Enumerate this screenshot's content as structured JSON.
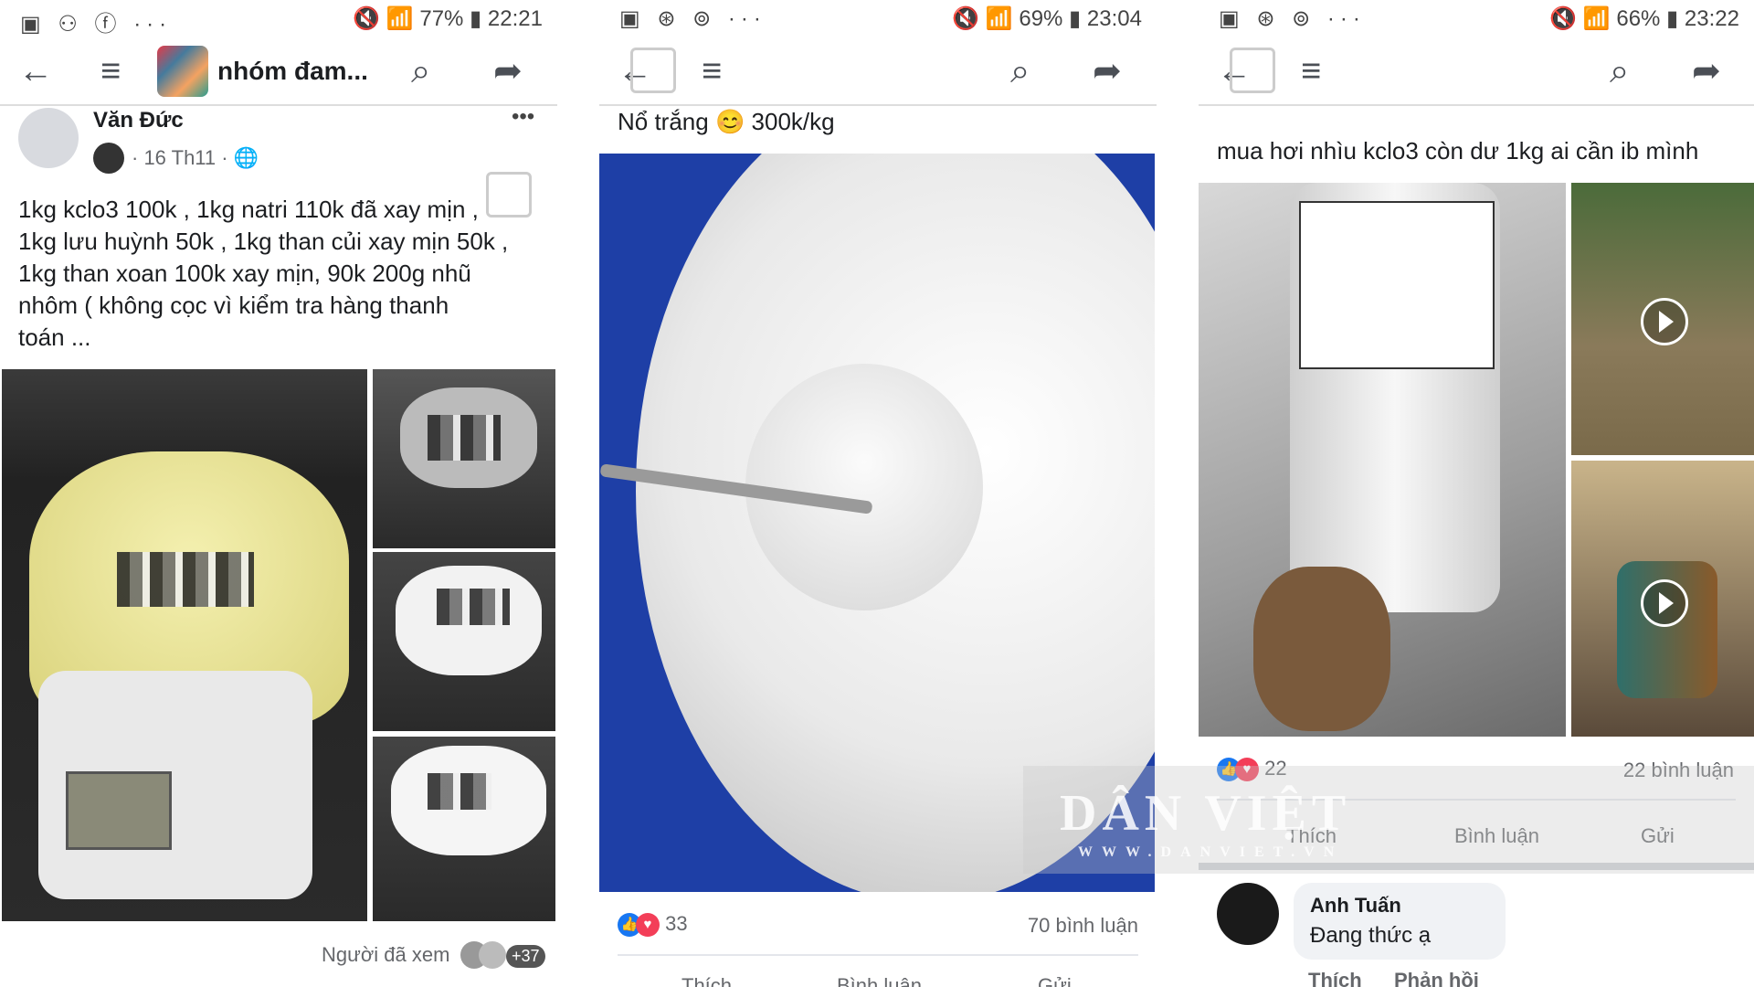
{
  "panel1": {
    "status": {
      "left_icons": "▣ ⚇ ⓕ ···",
      "right": "🔇 📶 77% ▮ 22:21"
    },
    "nav": {
      "back": "←",
      "menu": "≡",
      "title": "nhóm đam...",
      "search": "⌕",
      "share": "➦"
    },
    "post": {
      "author": "Văn Đức",
      "date": "· 16 Th11 · 🌐",
      "more": "•••",
      "text": [
        "1kg kclo3 100k , 1kg natri 110k đã xay mịn ,",
        "1kg lưu huỳnh 50k ,  1kg than củi xay mịn 50k ,",
        "1kg than xoan 100k xay mịn, 90k 200g nhũ",
        "nhôm ( không cọc vì kiểm tra hàng thanh",
        "toán ..."
      ],
      "seen": "Người đã xem",
      "seen_count": "+37"
    }
  },
  "panel2": {
    "status": {
      "left_icons": "▣ ⊛ ⊚ ···",
      "right": "🔇 📶 69% ▮ 23:04"
    },
    "nav": {
      "back": "←",
      "menu": "≡",
      "search": "⌕",
      "share": "➦"
    },
    "post": {
      "text": "Nổ trắng 😊 300k/kg",
      "reaction_count": "33",
      "comment_count": "70 bình luận",
      "actions": [
        "Thích",
        "Bình luận",
        "Gửi"
      ]
    }
  },
  "panel3": {
    "status": {
      "left_icons": "▣ ⊛ ⊚ ···",
      "right": "🔇 📶 66% ▮ 23:22"
    },
    "nav": {
      "back": "←",
      "menu": "≡",
      "search": "⌕",
      "share": "➦"
    },
    "post": {
      "text": "mua hơi nhìu kclo3 còn dư 1kg ai cần ib mình",
      "reaction_count": "22",
      "comment_count": "22 bình luận",
      "actions": [
        "Thích",
        "Bình luận",
        "Gửi"
      ],
      "comment": {
        "author": "Anh Tuấn",
        "text": "Đang thức ạ",
        "like": "Thích",
        "reply": "Phản hồi"
      }
    }
  },
  "watermark": {
    "text": "DÂN VIỆT",
    "sub": "WWW.DANVIET.VN"
  },
  "colors": {
    "fb_blue": "#1877f2",
    "heart": "#f33e58",
    "muted": "#65676b"
  }
}
